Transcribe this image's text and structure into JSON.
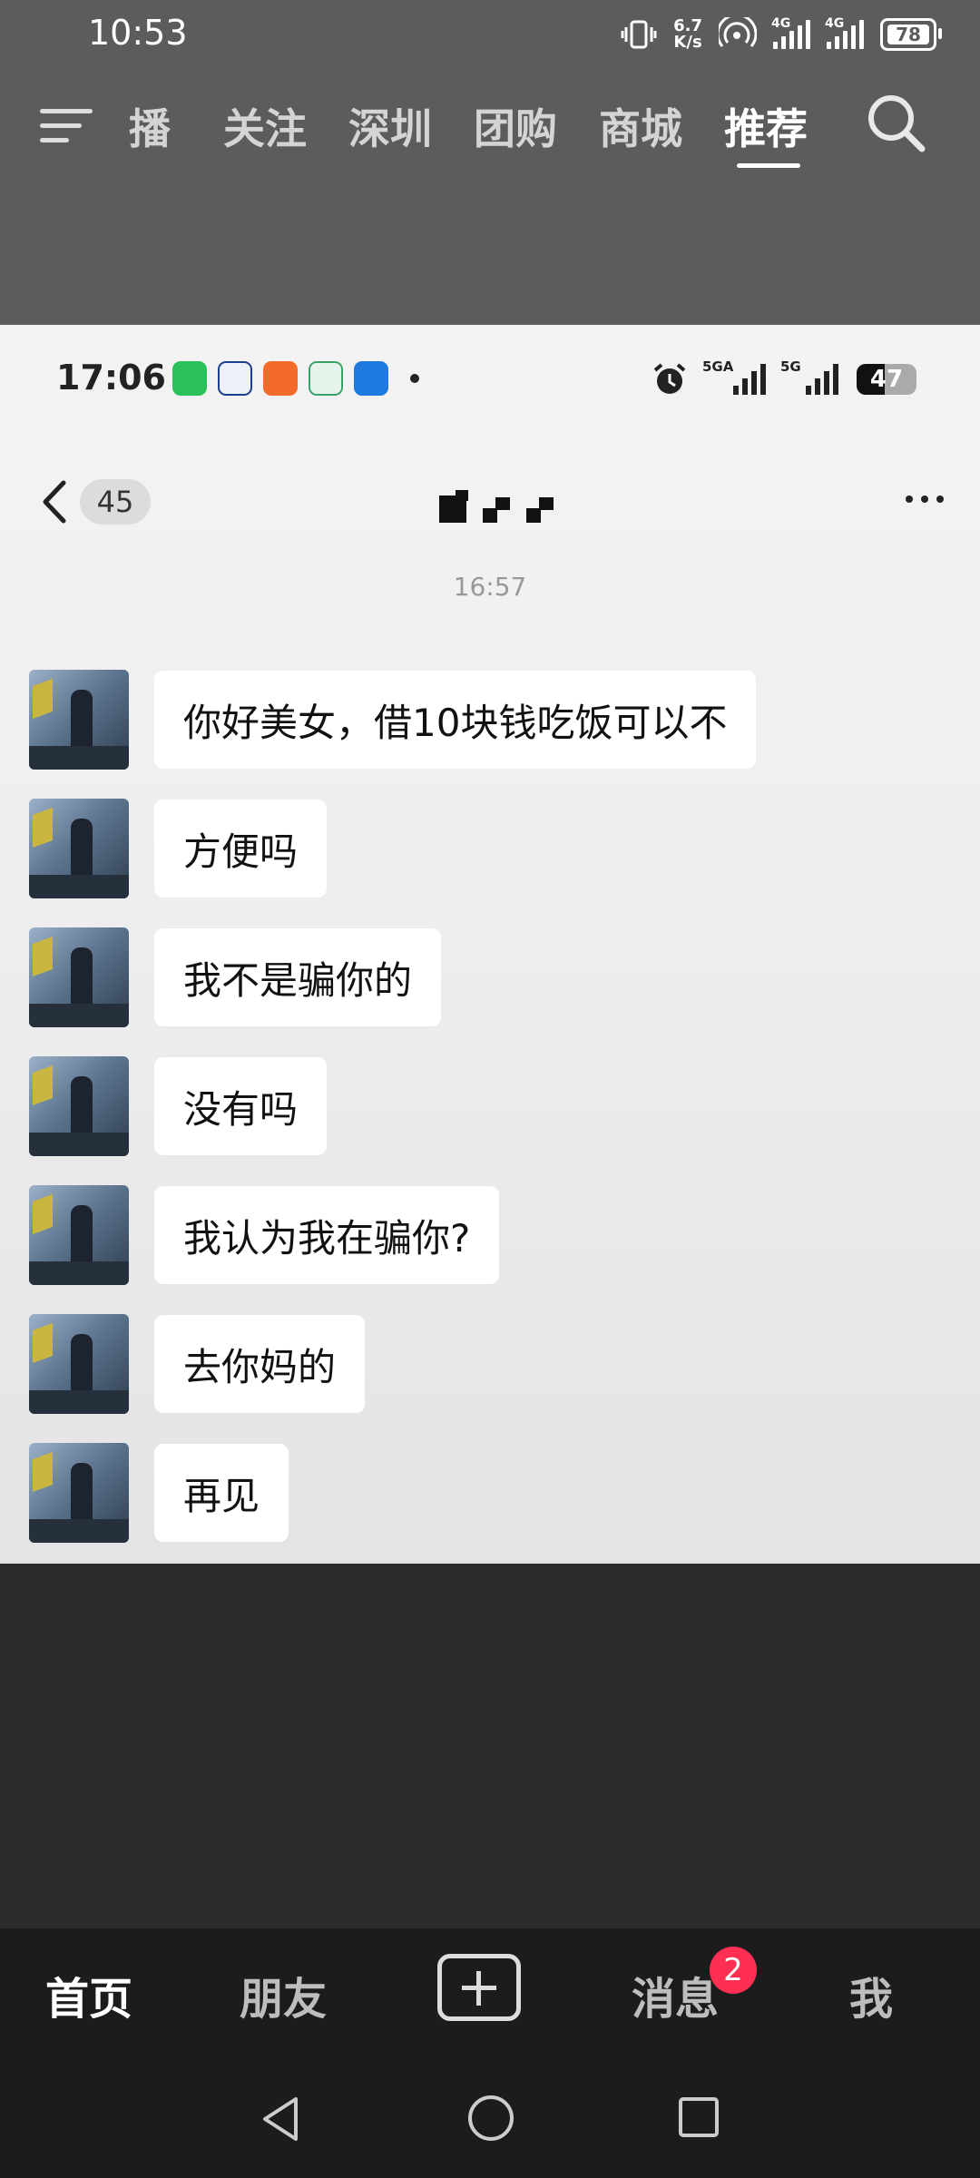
{
  "status_bar": {
    "time": "10:53",
    "speed_value": "6.7",
    "speed_unit": "K/s",
    "net_label_1": "4G",
    "net_label_2": "4G",
    "battery": "78"
  },
  "top_tabs": [
    {
      "label": "播"
    },
    {
      "label": "关注"
    },
    {
      "label": "深圳"
    },
    {
      "label": "团购"
    },
    {
      "label": "商城"
    },
    {
      "label": "推荐",
      "active": true
    }
  ],
  "embedded": {
    "status": {
      "time": "17:06",
      "net_label_1": "5GA",
      "net_label_2": "5G",
      "battery": "47"
    },
    "chat_header": {
      "unread_count": "45"
    },
    "timestamp": "16:57",
    "messages": [
      {
        "text": "你好美女，借10块钱吃饭可以不"
      },
      {
        "text": "方便吗"
      },
      {
        "text": "我不是骗你的"
      },
      {
        "text": "没有吗"
      },
      {
        "text": "我认为我在骗你?"
      },
      {
        "text": "去你妈的"
      },
      {
        "text": "再见"
      }
    ]
  },
  "bottom_nav": {
    "home": "首页",
    "friends": "朋友",
    "messages": "消息",
    "messages_badge": "2",
    "me": "我"
  }
}
